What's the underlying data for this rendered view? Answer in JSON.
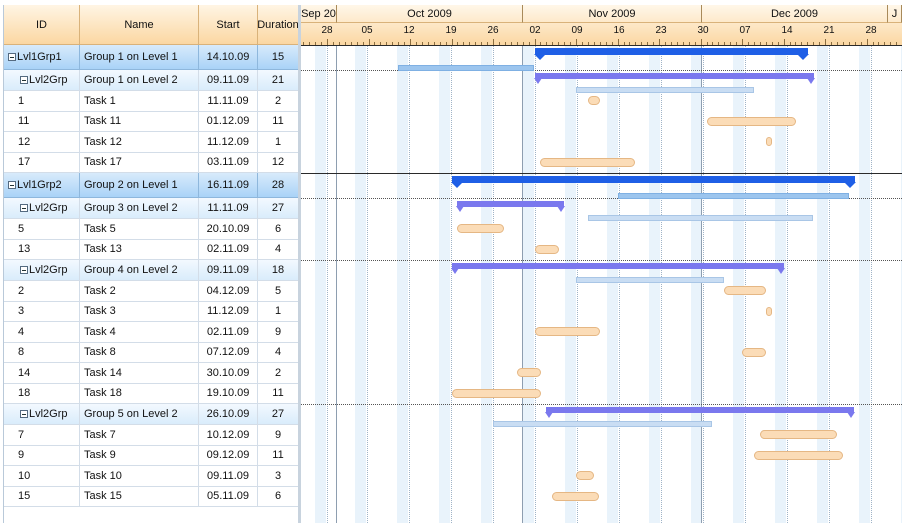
{
  "grid": {
    "columns": {
      "id": "ID",
      "name": "Name",
      "start": "Start",
      "duration": "Duration"
    },
    "rows": [
      {
        "level": 1,
        "id": "Lvl1Grp1",
        "name": "Group 1 on Level 1",
        "start": "14.10.09",
        "duration": "15"
      },
      {
        "level": 2,
        "id": "Lvl2Grp",
        "name": "Group 1 on Level 2",
        "start": "09.11.09",
        "duration": "21"
      },
      {
        "level": 3,
        "id": "1",
        "name": "Task 1",
        "start": "11.11.09",
        "duration": "2"
      },
      {
        "level": 3,
        "id": "11",
        "name": "Task 11",
        "start": "01.12.09",
        "duration": "11"
      },
      {
        "level": 3,
        "id": "12",
        "name": "Task 12",
        "start": "11.12.09",
        "duration": "1"
      },
      {
        "level": 3,
        "id": "17",
        "name": "Task 17",
        "start": "03.11.09",
        "duration": "12"
      },
      {
        "level": 1,
        "id": "Lvl1Grp2",
        "name": "Group 2 on Level 1",
        "start": "16.11.09",
        "duration": "28"
      },
      {
        "level": 2,
        "id": "Lvl2Grp",
        "name": "Group 3 on Level 2",
        "start": "11.11.09",
        "duration": "27"
      },
      {
        "level": 3,
        "id": "5",
        "name": "Task 5",
        "start": "20.10.09",
        "duration": "6"
      },
      {
        "level": 3,
        "id": "13",
        "name": "Task 13",
        "start": "02.11.09",
        "duration": "4"
      },
      {
        "level": 2,
        "id": "Lvl2Grp",
        "name": "Group 4 on Level 2",
        "start": "09.11.09",
        "duration": "18"
      },
      {
        "level": 3,
        "id": "2",
        "name": "Task 2",
        "start": "04.12.09",
        "duration": "5"
      },
      {
        "level": 3,
        "id": "3",
        "name": "Task 3",
        "start": "11.12.09",
        "duration": "1"
      },
      {
        "level": 3,
        "id": "4",
        "name": "Task 4",
        "start": "02.11.09",
        "duration": "9"
      },
      {
        "level": 3,
        "id": "8",
        "name": "Task 8",
        "start": "07.12.09",
        "duration": "4"
      },
      {
        "level": 3,
        "id": "14",
        "name": "Task 14",
        "start": "30.10.09",
        "duration": "2"
      },
      {
        "level": 3,
        "id": "18",
        "name": "Task 18",
        "start": "19.10.09",
        "duration": "11"
      },
      {
        "level": 2,
        "id": "Lvl2Grp",
        "name": "Group 5 on Level 2",
        "start": "26.10.09",
        "duration": "27"
      },
      {
        "level": 3,
        "id": "7",
        "name": "Task 7",
        "start": "10.12.09",
        "duration": "9"
      },
      {
        "level": 3,
        "id": "9",
        "name": "Task 9",
        "start": "09.12.09",
        "duration": "11"
      },
      {
        "level": 3,
        "id": "10",
        "name": "Task 10",
        "start": "09.11.09",
        "duration": "3"
      },
      {
        "level": 3,
        "id": "15",
        "name": "Task 15",
        "start": "05.11.09",
        "duration": "6"
      }
    ]
  },
  "timescale": {
    "months": [
      {
        "label": "Sep 20"
      },
      {
        "label": "Oct 2009"
      },
      {
        "label": "Nov 2009"
      },
      {
        "label": "Dec 2009"
      },
      {
        "label": "J"
      }
    ],
    "days": [
      "28",
      "05",
      "12",
      "19",
      "26",
      "02",
      "09",
      "16",
      "23",
      "30",
      "07",
      "14",
      "21",
      "28"
    ]
  },
  "colors": {
    "summary_level1": "#1f5fe6",
    "summary_level2": "#7a78ee",
    "baseline": "#c9ddf3",
    "task": "#fbdcb7",
    "header": "#fbd7a2",
    "group_row": "#a9d3f7"
  },
  "gantt": {
    "scale_start": "2009-09-24",
    "bars": [
      {
        "row": 0,
        "type": "summary1",
        "from": "2009-11-02",
        "to": "2009-12-18"
      },
      {
        "row": 0,
        "type": "baseline1",
        "from": "2009-10-10",
        "to": "2009-11-02"
      },
      {
        "row": 1,
        "type": "summary2",
        "from": "2009-11-02",
        "to": "2009-12-19"
      },
      {
        "row": 1,
        "type": "baseline",
        "from": "2009-11-09",
        "to": "2009-12-09"
      },
      {
        "row": 2,
        "type": "task",
        "from": "2009-11-11",
        "to": "2009-11-13"
      },
      {
        "row": 3,
        "type": "task",
        "from": "2009-12-01",
        "to": "2009-12-16"
      },
      {
        "row": 4,
        "type": "task",
        "from": "2009-12-11",
        "to": "2009-12-12"
      },
      {
        "row": 5,
        "type": "task",
        "from": "2009-11-03",
        "to": "2009-11-19"
      },
      {
        "row": 6,
        "type": "summary1",
        "from": "2009-10-19",
        "to": "2009-12-26"
      },
      {
        "row": 6,
        "type": "baseline1",
        "from": "2009-11-16",
        "to": "2009-12-25"
      },
      {
        "row": 7,
        "type": "summary2",
        "from": "2009-10-20",
        "to": "2009-11-07"
      },
      {
        "row": 7,
        "type": "baseline",
        "from": "2009-11-11",
        "to": "2009-12-19"
      },
      {
        "row": 8,
        "type": "task",
        "from": "2009-10-20",
        "to": "2009-10-28"
      },
      {
        "row": 9,
        "type": "task",
        "from": "2009-11-02",
        "to": "2009-11-06"
      },
      {
        "row": 10,
        "type": "summary2",
        "from": "2009-10-19",
        "to": "2009-12-14"
      },
      {
        "row": 10,
        "type": "baseline",
        "from": "2009-11-09",
        "to": "2009-12-04"
      },
      {
        "row": 11,
        "type": "task",
        "from": "2009-12-04",
        "to": "2009-12-11"
      },
      {
        "row": 12,
        "type": "task",
        "from": "2009-12-11",
        "to": "2009-12-12"
      },
      {
        "row": 13,
        "type": "task",
        "from": "2009-11-02",
        "to": "2009-11-13"
      },
      {
        "row": 14,
        "type": "task",
        "from": "2009-12-07",
        "to": "2009-12-11"
      },
      {
        "row": 15,
        "type": "task",
        "from": "2009-10-30",
        "to": "2009-11-03"
      },
      {
        "row": 16,
        "type": "task",
        "from": "2009-10-19",
        "to": "2009-11-03"
      },
      {
        "row": 17,
        "type": "summary2",
        "from": "2009-11-04",
        "to": "2009-12-26"
      },
      {
        "row": 17,
        "type": "baseline",
        "from": "2009-10-26",
        "to": "2009-12-02"
      },
      {
        "row": 18,
        "type": "task",
        "from": "2009-12-10",
        "to": "2009-12-23"
      },
      {
        "row": 19,
        "type": "task",
        "from": "2009-12-09",
        "to": "2009-12-24"
      },
      {
        "row": 20,
        "type": "task",
        "from": "2009-11-09",
        "to": "2009-11-12"
      },
      {
        "row": 21,
        "type": "task",
        "from": "2009-11-05",
        "to": "2009-11-13"
      }
    ]
  }
}
